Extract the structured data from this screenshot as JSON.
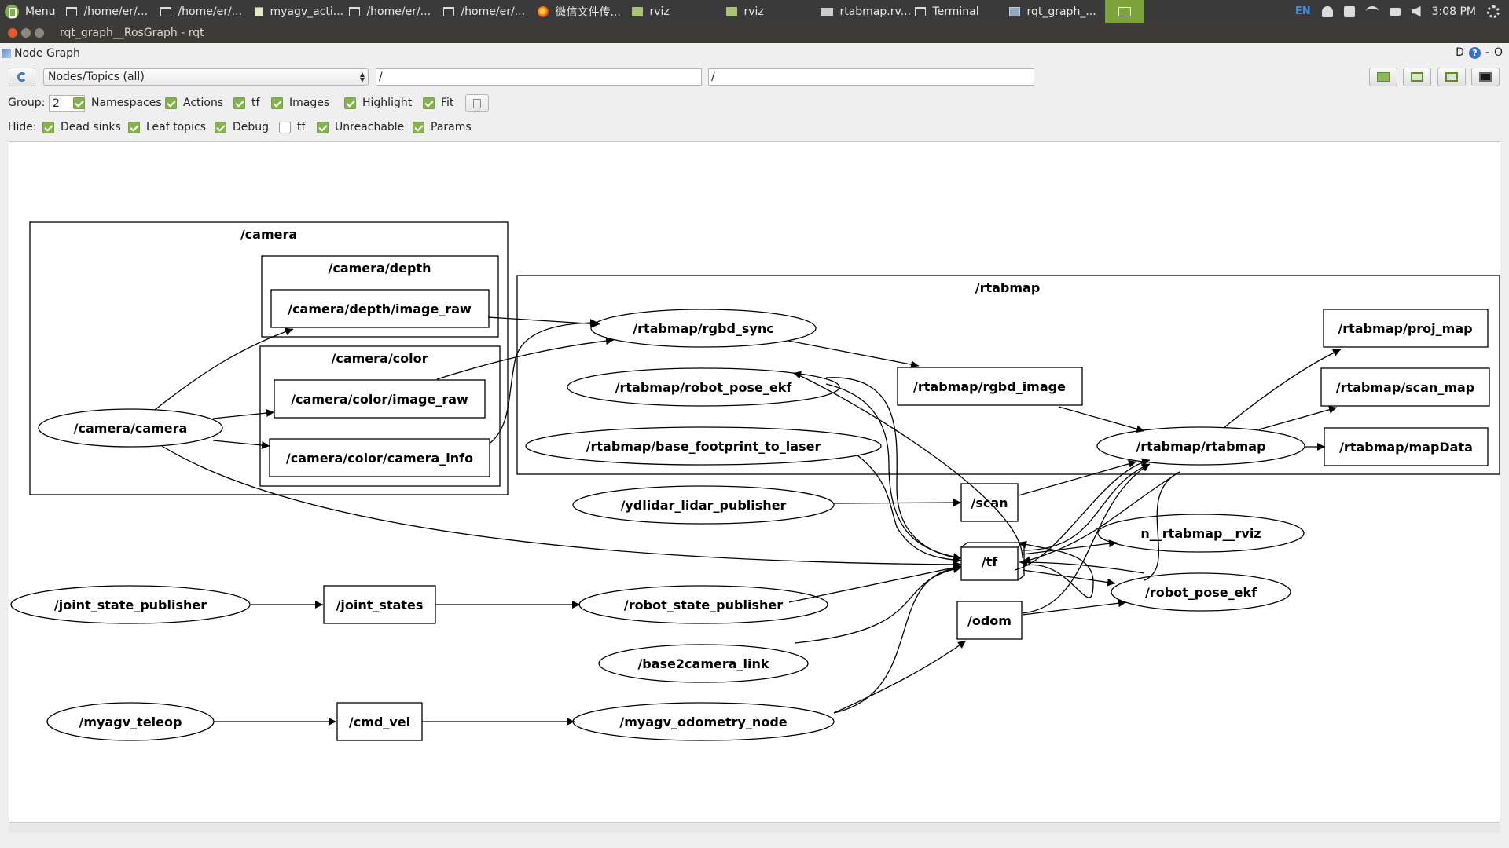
{
  "panel": {
    "menu_label": "Menu",
    "tasks": [
      {
        "label": "/home/er/...",
        "icon": "terminal-window-icon"
      },
      {
        "label": "/home/er/...",
        "icon": "terminal-window-icon"
      },
      {
        "label": "myagv_acti...",
        "icon": "text-editor-icon"
      },
      {
        "label": "/home/er/...",
        "icon": "terminal-window-icon"
      },
      {
        "label": "/home/er/...",
        "icon": "terminal-window-icon"
      },
      {
        "label": "微信文件传...",
        "icon": "firefox-icon"
      },
      {
        "label": "rviz",
        "icon": "folder-icon"
      },
      {
        "label": "rviz",
        "icon": "folder-icon"
      },
      {
        "label": "rtabmap.rv...",
        "icon": "rviz-icon"
      },
      {
        "label": "Terminal",
        "icon": "terminal-window-icon"
      },
      {
        "label": "rqt_graph_...",
        "icon": "rqt-icon"
      }
    ],
    "tray": {
      "lang": "EN",
      "clock": "3:08 PM"
    }
  },
  "window": {
    "title": "rqt_graph__RosGraph - rqt"
  },
  "plugin": {
    "title": "Node Graph",
    "right_d": "D",
    "right_dash": "-",
    "right_o": "O"
  },
  "toolbar": {
    "graph_type": "Nodes/Topics (all)",
    "node_filter": "/",
    "topic_filter": "/"
  },
  "group_row": {
    "group_label": "Group:",
    "group_value": "2",
    "options": [
      {
        "label": "Namespaces",
        "checked": true
      },
      {
        "label": "Actions",
        "checked": true
      },
      {
        "label": "tf",
        "checked": true
      },
      {
        "label": "Images",
        "checked": true
      },
      {
        "label": "Highlight",
        "checked": true
      },
      {
        "label": "Fit",
        "checked": true
      }
    ]
  },
  "hide_row": {
    "hide_label": "Hide:",
    "options": [
      {
        "label": "Dead sinks",
        "checked": true
      },
      {
        "label": "Leaf topics",
        "checked": true
      },
      {
        "label": "Debug",
        "checked": true
      },
      {
        "label": "tf",
        "checked": false
      },
      {
        "label": "Unreachable",
        "checked": true
      },
      {
        "label": "Params",
        "checked": true
      }
    ]
  },
  "graph": {
    "clusters": {
      "camera": "/camera",
      "camera_depth": "/camera/depth",
      "camera_color": "/camera/color",
      "rtabmap": "/rtabmap"
    },
    "nodes": {
      "camera_camera": "/camera/camera",
      "rgbd_sync": "/rtabmap/rgbd_sync",
      "robot_pose_ekf_rtab": "/rtabmap/robot_pose_ekf",
      "base_footprint_to_laser": "/rtabmap/base_footprint_to_laser",
      "rtabmap": "/rtabmap/rtabmap",
      "ydlidar": "/ydlidar_lidar_publisher",
      "rviz": "n__rtabmap__rviz",
      "robot_pose_ekf": "/robot_pose_ekf",
      "joint_state_publisher": "/joint_state_publisher",
      "robot_state_publisher": "/robot_state_publisher",
      "base2camera_link": "/base2camera_link",
      "myagv_teleop": "/myagv_teleop",
      "myagv_odometry_node": "/myagv_odometry_node"
    },
    "topics": {
      "depth_image_raw": "/camera/depth/image_raw",
      "color_image_raw": "/camera/color/image_raw",
      "color_camera_info": "/camera/color/camera_info",
      "rgbd_image": "/rtabmap/rgbd_image",
      "proj_map": "/rtabmap/proj_map",
      "scan_map": "/rtabmap/scan_map",
      "mapData": "/rtabmap/mapData",
      "scan": "/scan",
      "tf": "/tf",
      "odom": "/odom",
      "joint_states": "/joint_states",
      "cmd_vel": "/cmd_vel"
    }
  }
}
